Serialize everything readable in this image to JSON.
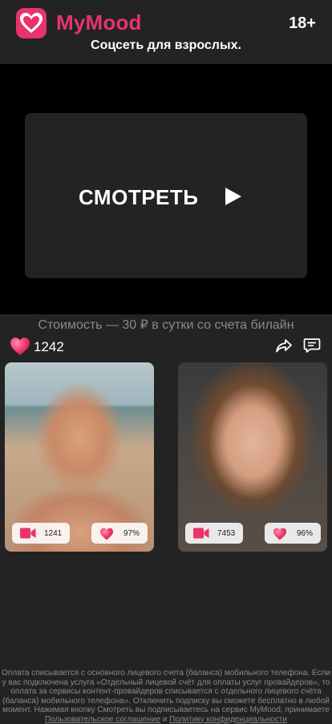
{
  "header": {
    "brand": "MyMood",
    "age_badge": "18+",
    "tagline": "Соцсеть для взрослых."
  },
  "player": {
    "watch_label": "СМОТРЕТЬ"
  },
  "price_text": "Стоимость — 30 ₽ в сутки со счета билайн",
  "likes": {
    "count": "1242"
  },
  "cards": [
    {
      "views": "1241",
      "rating": "97%"
    },
    {
      "views": "7453",
      "rating": "96%"
    }
  ],
  "footer": {
    "text1": "Оплата списывается с основного лицевого счета (баланса) мобильного телефона. Если у вас подключена услуга «Отдельный лицевой счёт для оплаты услуг провайдеров», то оплата за сервисы контент-провайдеров списывается с отдельного лицевого счёта (баланса) мобильного телефона». Отключить подписку вы сможете бесплатно в любой момент. Нажимая кнопку Смотреть вы подписываетесь на сервис MyMood, принимаете ",
    "link1": "Пользовательское соглашение",
    "and": " и ",
    "link2": "Политику конфиденциальности"
  },
  "colors": {
    "brand": "#e8336d",
    "background": "#232323",
    "player_bg": "#000000",
    "muted_text": "#8a8a8a"
  },
  "icons": [
    "heart-logo-icon",
    "play-icon",
    "heart-icon",
    "share-icon",
    "comment-icon",
    "video-camera-icon"
  ]
}
